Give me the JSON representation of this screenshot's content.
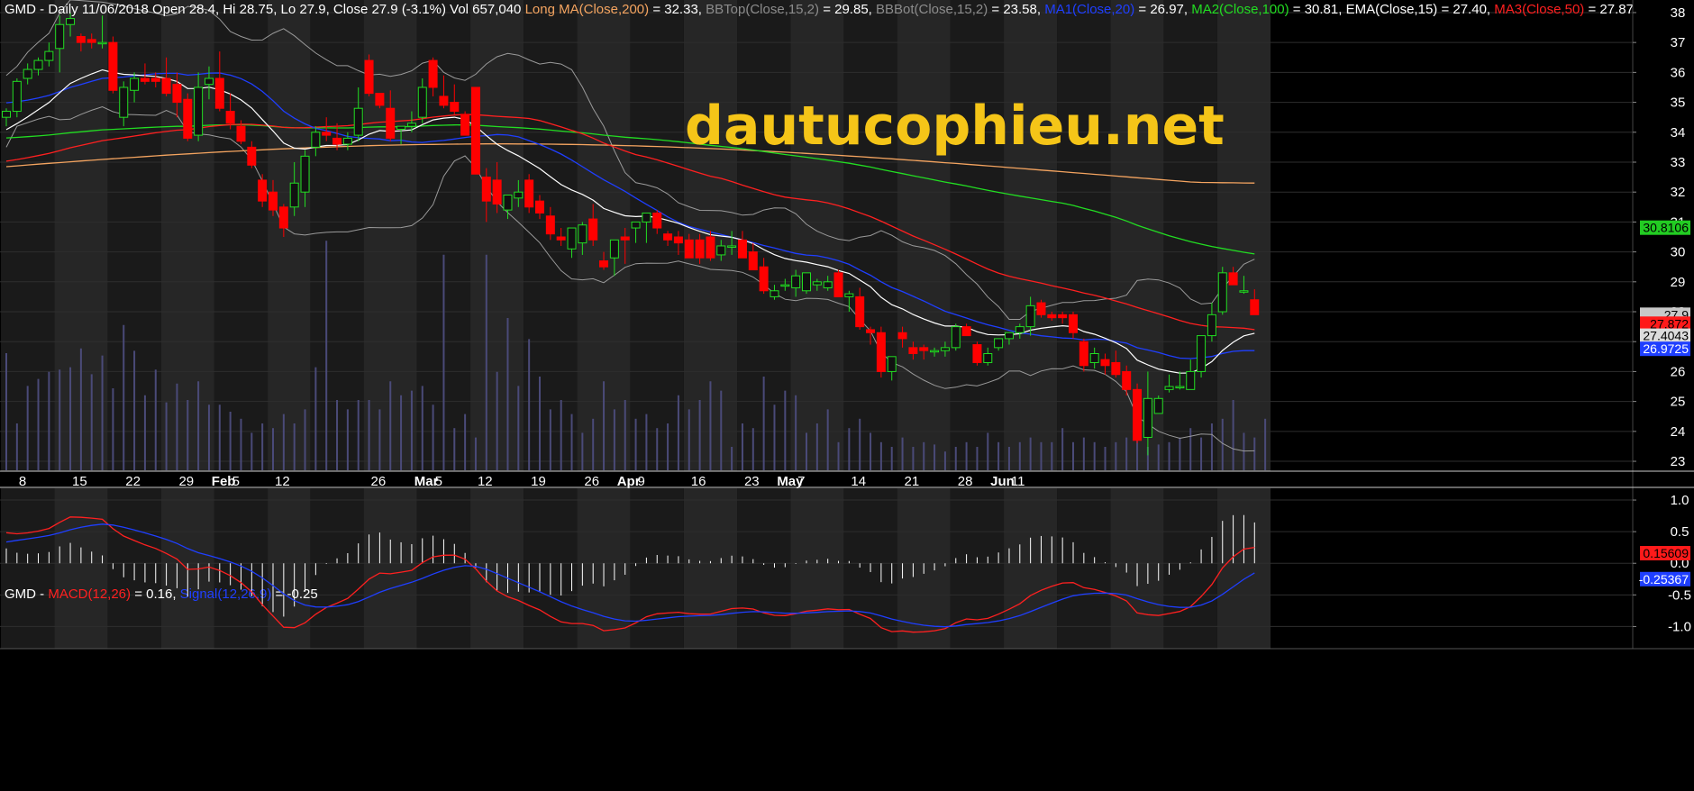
{
  "header": {
    "main": [
      {
        "text": "GMD - Daily 11/06/2018 Open 28.4, Hi 28.75, Lo 27.9, Close 27.9 (-3.1%) Vol 657,040 ",
        "color": "#ffffff"
      },
      {
        "text": "Long MA(Close,200)",
        "color": "#f4a460"
      },
      {
        "text": " = 32.33, ",
        "color": "#ffffff"
      },
      {
        "text": "BBTop(Close,15,2)",
        "color": "#8c8c8c"
      },
      {
        "text": " = 29.85, ",
        "color": "#ffffff"
      },
      {
        "text": "BBBot(Close,15,2)",
        "color": "#8c8c8c"
      },
      {
        "text": " = 23.58, ",
        "color": "#ffffff"
      },
      {
        "text": "MA1(Close,20)",
        "color": "#1f3fff"
      },
      {
        "text": " = 26.97, ",
        "color": "#ffffff"
      },
      {
        "text": "MA2(Close,100)",
        "color": "#22dd22"
      },
      {
        "text": " = 30.81, ",
        "color": "#ffffff"
      },
      {
        "text": "EMA(Close,15)",
        "color": "#ffffff"
      },
      {
        "text": " = 27.40, ",
        "color": "#ffffff"
      },
      {
        "text": "MA3(Close,50)",
        "color": "#ff2020"
      },
      {
        "text": " = 27.87",
        "color": "#ffffff"
      }
    ],
    "macd": [
      {
        "text": "GMD - ",
        "color": "#ffffff"
      },
      {
        "text": "MACD(12,26)",
        "color": "#ff2020"
      },
      {
        "text": " = 0.16, ",
        "color": "#ffffff"
      },
      {
        "text": "Signal(12,26,9)",
        "color": "#1f3fff"
      },
      {
        "text": " = -0.25",
        "color": "#ffffff"
      }
    ]
  },
  "watermark": "dautucophieu.net",
  "x_axis": {
    "labels": [
      {
        "text": "8",
        "bold": false
      },
      {
        "text": "15",
        "bold": false
      },
      {
        "text": "22",
        "bold": false
      },
      {
        "text": "29",
        "bold": false
      },
      {
        "text": "Feb",
        "bold": true
      },
      {
        "text": "5",
        "bold": false
      },
      {
        "text": "12",
        "bold": false
      },
      {
        "text": "26",
        "bold": false
      },
      {
        "text": "Mar",
        "bold": true
      },
      {
        "text": "5",
        "bold": false
      },
      {
        "text": "12",
        "bold": false
      },
      {
        "text": "19",
        "bold": false
      },
      {
        "text": "26",
        "bold": false
      },
      {
        "text": "Apr",
        "bold": true
      },
      {
        "text": "9",
        "bold": false
      },
      {
        "text": "16",
        "bold": false
      },
      {
        "text": "23",
        "bold": false
      },
      {
        "text": "May",
        "bold": true
      },
      {
        "text": "7",
        "bold": false
      },
      {
        "text": "14",
        "bold": false
      },
      {
        "text": "21",
        "bold": false
      },
      {
        "text": "28",
        "bold": false
      },
      {
        "text": "Jun",
        "bold": true
      },
      {
        "text": "11",
        "bold": false
      }
    ]
  },
  "price_tags": [
    {
      "text": "30.8106",
      "value": 30.81,
      "bg": "#22cc22",
      "fg": "#000000"
    },
    {
      "text": "27.9",
      "value": 27.9,
      "bg": "#c8c8c8",
      "fg": "#000000"
    },
    {
      "text": "27.872",
      "value": 27.6,
      "bg": "#ff1a1a",
      "fg": "#000000"
    },
    {
      "text": "27.4043",
      "value": 27.2,
      "bg": "#dcdcdc",
      "fg": "#000000"
    },
    {
      "text": "26.9725",
      "value": 26.76,
      "bg": "#1f3fff",
      "fg": "#ffffff"
    }
  ],
  "macd_tags": [
    {
      "text": "0.15609",
      "value": 0.16,
      "bg": "#ff1a1a",
      "fg": "#000000"
    },
    {
      "text": "-0.25367",
      "value": -0.25,
      "bg": "#1f3fff",
      "fg": "#ffffff"
    }
  ],
  "colors": {
    "up": "#22dd22",
    "down": "#ff0000",
    "bb": "#9a9a9a",
    "ema": "#ffffff",
    "ma20": "#1f3fff",
    "ma50": "#ff2020",
    "ma100": "#22dd22",
    "ma200": "#f4a460",
    "volume": "#4a4a78",
    "macd_line": "#ff2020",
    "signal_line": "#1f3fff",
    "hist": "#ffffff"
  },
  "chart_data": [
    {
      "type": "candlestick",
      "name": "GMD",
      "yticks": [
        23,
        24,
        25,
        26,
        27,
        28,
        29,
        30,
        31,
        32,
        33,
        34,
        35,
        36,
        37,
        38
      ],
      "ylim": [
        22.7,
        38.3
      ],
      "grid": true,
      "candles": [
        [
          34.5,
          34.8,
          34.2,
          34.7
        ],
        [
          34.7,
          35.8,
          34.5,
          35.7
        ],
        [
          35.8,
          36.3,
          35.6,
          36.1
        ],
        [
          36.1,
          36.5,
          35.9,
          36.4
        ],
        [
          36.4,
          37.0,
          36.2,
          36.7
        ],
        [
          36.8,
          37.9,
          36.0,
          37.6
        ],
        [
          37.6,
          38.0,
          37.2,
          37.8
        ],
        [
          37.2,
          37.3,
          36.7,
          37.0
        ],
        [
          37.1,
          37.3,
          36.8,
          37.0
        ],
        [
          37.0,
          37.9,
          36.8,
          37.0
        ],
        [
          37.0,
          37.2,
          35.3,
          35.4
        ],
        [
          34.5,
          35.7,
          34.2,
          35.5
        ],
        [
          35.4,
          36.0,
          35.0,
          35.8
        ],
        [
          35.8,
          36.3,
          35.6,
          35.7
        ],
        [
          35.8,
          36.0,
          35.5,
          35.7
        ],
        [
          35.8,
          36.5,
          35.2,
          35.3
        ],
        [
          35.6,
          36.0,
          34.5,
          35.0
        ],
        [
          35.1,
          35.3,
          33.7,
          33.8
        ],
        [
          33.9,
          36.0,
          33.7,
          35.5
        ],
        [
          35.6,
          36.2,
          35.1,
          35.8
        ],
        [
          35.8,
          36.7,
          34.7,
          34.8
        ],
        [
          34.7,
          35.3,
          34.1,
          34.3
        ],
        [
          34.2,
          34.4,
          33.6,
          33.7
        ],
        [
          33.5,
          33.7,
          32.8,
          32.9
        ],
        [
          32.4,
          32.6,
          31.5,
          31.7
        ],
        [
          32.0,
          32.4,
          31.2,
          31.4
        ],
        [
          31.5,
          31.6,
          30.5,
          30.8
        ],
        [
          31.5,
          33.0,
          31.2,
          32.3
        ],
        [
          32.0,
          33.4,
          31.5,
          33.2
        ],
        [
          33.5,
          34.2,
          33.2,
          34.0
        ],
        [
          34.0,
          34.5,
          33.7,
          33.9
        ],
        [
          33.8,
          34.3,
          33.4,
          33.6
        ],
        [
          33.6,
          34.0,
          33.4,
          33.8
        ],
        [
          33.9,
          35.5,
          33.7,
          34.8
        ],
        [
          36.4,
          36.6,
          35.2,
          35.3
        ],
        [
          35.3,
          35.3,
          34.8,
          34.9
        ],
        [
          34.8,
          35.4,
          33.7,
          33.8
        ],
        [
          34.1,
          34.2,
          33.6,
          34.2
        ],
        [
          34.2,
          34.7,
          34.0,
          34.3
        ],
        [
          34.5,
          35.8,
          34.3,
          35.5
        ],
        [
          36.4,
          36.5,
          35.2,
          35.5
        ],
        [
          35.2,
          35.9,
          34.8,
          34.9
        ],
        [
          35.0,
          35.6,
          34.6,
          34.7
        ],
        [
          34.6,
          34.7,
          33.9,
          33.9
        ],
        [
          35.5,
          35.5,
          32.6,
          32.6
        ],
        [
          32.5,
          32.8,
          31.0,
          31.7
        ],
        [
          32.4,
          33.0,
          31.3,
          31.6
        ],
        [
          31.4,
          31.8,
          31.1,
          31.9
        ],
        [
          31.8,
          32.4,
          31.5,
          32.0
        ],
        [
          32.4,
          32.6,
          31.3,
          31.5
        ],
        [
          31.7,
          31.9,
          31.1,
          31.3
        ],
        [
          31.2,
          31.5,
          30.4,
          30.6
        ],
        [
          30.5,
          30.8,
          30.2,
          30.4
        ],
        [
          30.1,
          30.6,
          29.8,
          30.8
        ],
        [
          30.3,
          31.0,
          29.9,
          30.9
        ],
        [
          31.1,
          31.6,
          30.2,
          30.4
        ],
        [
          29.7,
          30.0,
          29.4,
          29.5
        ],
        [
          29.8,
          30.0,
          29.2,
          30.4
        ],
        [
          30.5,
          30.8,
          29.6,
          30.4
        ],
        [
          30.8,
          31.0,
          30.3,
          31.0
        ],
        [
          31.0,
          31.2,
          30.3,
          31.3
        ],
        [
          31.3,
          31.4,
          30.6,
          30.8
        ],
        [
          30.6,
          30.7,
          30.2,
          30.4
        ],
        [
          30.5,
          30.7,
          29.9,
          30.3
        ],
        [
          30.4,
          30.6,
          29.8,
          29.8
        ],
        [
          30.4,
          30.6,
          29.6,
          29.8
        ],
        [
          30.5,
          30.7,
          29.7,
          29.8
        ],
        [
          29.9,
          30.4,
          29.7,
          30.2
        ],
        [
          30.2,
          30.7,
          29.9,
          30.2
        ],
        [
          30.4,
          30.7,
          29.9,
          29.8
        ],
        [
          30.0,
          30.3,
          29.4,
          29.4
        ],
        [
          29.5,
          29.8,
          28.6,
          28.7
        ],
        [
          28.5,
          28.9,
          28.4,
          28.7
        ],
        [
          28.9,
          29.1,
          28.7,
          28.9
        ],
        [
          28.8,
          29.4,
          28.5,
          29.2
        ],
        [
          28.7,
          29.2,
          28.6,
          29.3
        ],
        [
          28.9,
          29.1,
          28.7,
          29.0
        ],
        [
          28.8,
          29.2,
          28.7,
          29.0
        ],
        [
          29.3,
          29.4,
          29.0,
          28.5
        ],
        [
          28.5,
          28.7,
          28.0,
          28.6
        ],
        [
          28.5,
          28.8,
          27.4,
          27.5
        ],
        [
          27.4,
          27.5,
          26.9,
          27.3
        ],
        [
          27.3,
          27.5,
          25.8,
          26.0
        ],
        [
          26.0,
          26.5,
          25.7,
          26.5
        ],
        [
          27.3,
          27.5,
          26.8,
          27.1
        ],
        [
          26.8,
          27.0,
          26.4,
          26.6
        ],
        [
          26.8,
          26.9,
          26.4,
          26.7
        ],
        [
          26.7,
          26.8,
          26.5,
          26.7
        ],
        [
          26.7,
          27.0,
          26.5,
          26.8
        ],
        [
          26.8,
          27.6,
          26.7,
          27.5
        ],
        [
          27.5,
          27.6,
          27.3,
          27.2
        ],
        [
          26.9,
          27.0,
          26.2,
          26.3
        ],
        [
          26.3,
          26.8,
          26.2,
          26.6
        ],
        [
          26.8,
          27.0,
          26.7,
          27.1
        ],
        [
          27.1,
          27.3,
          26.9,
          27.3
        ],
        [
          27.3,
          27.6,
          27.1,
          27.5
        ],
        [
          27.5,
          28.5,
          27.2,
          28.2
        ],
        [
          28.3,
          28.4,
          27.8,
          27.9
        ],
        [
          27.9,
          28.0,
          27.7,
          27.8
        ],
        [
          27.9,
          28.0,
          27.6,
          27.8
        ],
        [
          27.9,
          28.0,
          27.1,
          27.3
        ],
        [
          27.0,
          27.1,
          26.0,
          26.2
        ],
        [
          26.3,
          26.8,
          26.1,
          26.6
        ],
        [
          26.4,
          26.6,
          25.9,
          26.2
        ],
        [
          26.3,
          26.7,
          25.8,
          25.9
        ],
        [
          26.0,
          26.2,
          25.2,
          25.4
        ],
        [
          25.4,
          25.6,
          23.6,
          23.7
        ],
        [
          23.8,
          26.0,
          23.2,
          25.1
        ],
        [
          24.6,
          25.2,
          24.6,
          25.1
        ],
        [
          25.4,
          25.9,
          25.3,
          25.5
        ],
        [
          25.5,
          26.0,
          25.4,
          25.5
        ],
        [
          25.4,
          26.4,
          25.4,
          26.0
        ],
        [
          26.0,
          27.0,
          25.8,
          27.2
        ],
        [
          27.2,
          28.3,
          27.0,
          27.9
        ],
        [
          28.0,
          29.5,
          27.9,
          29.3
        ],
        [
          29.3,
          29.5,
          28.9,
          28.9
        ],
        [
          28.7,
          29.2,
          28.6,
          28.7
        ],
        [
          28.4,
          28.75,
          27.9,
          27.9
        ]
      ],
      "volume_ratio": [
        0.5,
        0.2,
        0.36,
        0.39,
        0.42,
        0.43,
        0.44,
        0.52,
        0.41,
        0.49,
        0.35,
        0.62,
        0.51,
        0.32,
        0.43,
        0.29,
        0.37,
        0.3,
        0.38,
        0.28,
        0.28,
        0.25,
        0.22,
        0.16,
        0.2,
        0.18,
        0.24,
        0.2,
        0.26,
        0.44,
        0.46,
        0.3,
        0.26,
        0.3,
        0.3,
        0.26,
        0.38,
        0.32,
        0.34,
        0.36,
        0.28,
        0.2,
        0.18,
        0.24,
        0.14,
        0.4,
        0.42,
        0.3,
        0.36,
        0.56,
        0.4,
        0.26,
        0.3,
        0.24,
        0.16,
        0.22,
        0.38,
        0.26,
        0.3,
        0.22,
        0.24,
        0.18,
        0.2,
        0.32,
        0.26,
        0.3,
        0.38,
        0.34,
        0.1,
        0.2,
        0.18,
        0.4,
        0.28,
        0.34,
        0.32,
        0.16,
        0.2,
        0.26,
        0.12,
        0.18,
        0.22,
        0.16,
        0.12,
        0.1,
        0.14,
        0.1,
        0.12,
        0.11,
        0.08,
        0.1,
        0.12,
        0.1,
        0.16,
        0.12,
        0.1,
        0.12,
        0.14,
        0.12,
        0.12,
        0.18,
        0.12,
        0.14,
        0.12,
        0.1,
        0.12,
        0.14,
        0.16,
        0.1,
        0.11,
        0.12,
        0.14,
        0.18,
        0.14,
        0.2,
        0.22,
        0.3,
        0.16,
        0.14,
        0.22
      ],
      "volume_spikes": {
        "30": 0.98,
        "41": 0.92,
        "45": 0.92,
        "47": 0.65
      }
    },
    {
      "type": "line",
      "name": "MACD",
      "yticks": [
        -1.0,
        -0.5,
        0.0,
        0.5,
        1.0
      ],
      "ylim": [
        -1.35,
        1.2
      ],
      "grid": true
    }
  ]
}
